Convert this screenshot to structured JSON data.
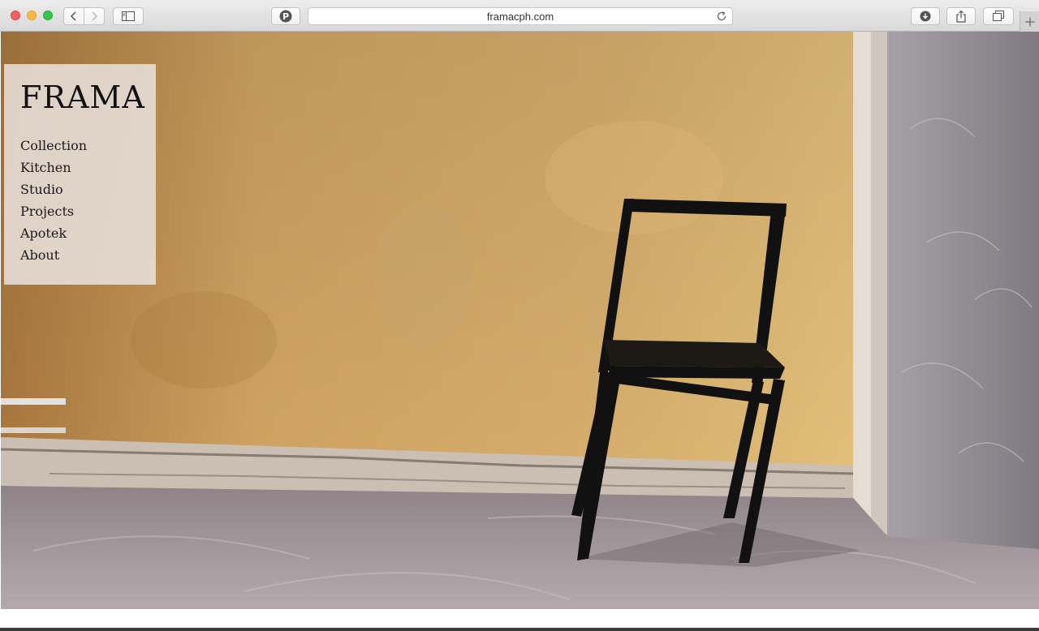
{
  "browser": {
    "url": "framacph.com",
    "icons": {
      "back": "chevron-left-icon",
      "forward": "chevron-right-icon",
      "sidebar": "sidebar-icon",
      "pinterest": "pinterest-icon",
      "reload": "reload-icon",
      "download": "download-icon",
      "share": "share-icon",
      "tabs": "tabs-icon",
      "new_tab": "plus-icon"
    }
  },
  "site": {
    "logo": "FRAMA",
    "nav": [
      "Collection",
      "Kitchen",
      "Studio",
      "Projects",
      "Apotek",
      "About"
    ]
  },
  "colors": {
    "wall": "#c99d59",
    "concrete": "#8f8890",
    "floor": "#a69aa0",
    "chair": "#111111",
    "menu_panel": "#e7dfdb"
  }
}
